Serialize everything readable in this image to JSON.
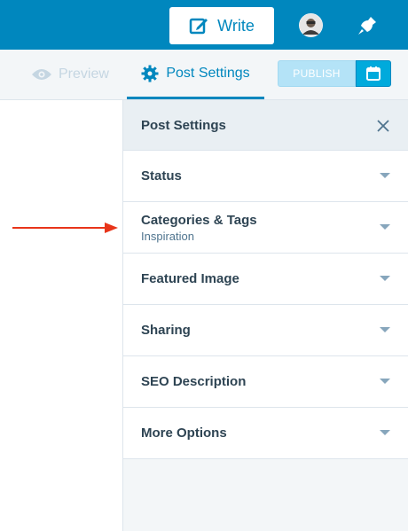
{
  "masterbar": {
    "write_label": "Write",
    "colors": {
      "bar": "#0087be"
    }
  },
  "toolbar": {
    "preview_label": "Preview",
    "settings_label": "Post Settings",
    "publish_label": "PUBLISH"
  },
  "sidebar": {
    "title": "Post Settings",
    "sections": [
      {
        "label": "Status",
        "sub": ""
      },
      {
        "label": "Categories & Tags",
        "sub": "Inspiration"
      },
      {
        "label": "Featured Image",
        "sub": ""
      },
      {
        "label": "Sharing",
        "sub": ""
      },
      {
        "label": "SEO Description",
        "sub": ""
      },
      {
        "label": "More Options",
        "sub": ""
      }
    ]
  },
  "annotation": {
    "arrow_color": "#e8351a"
  }
}
